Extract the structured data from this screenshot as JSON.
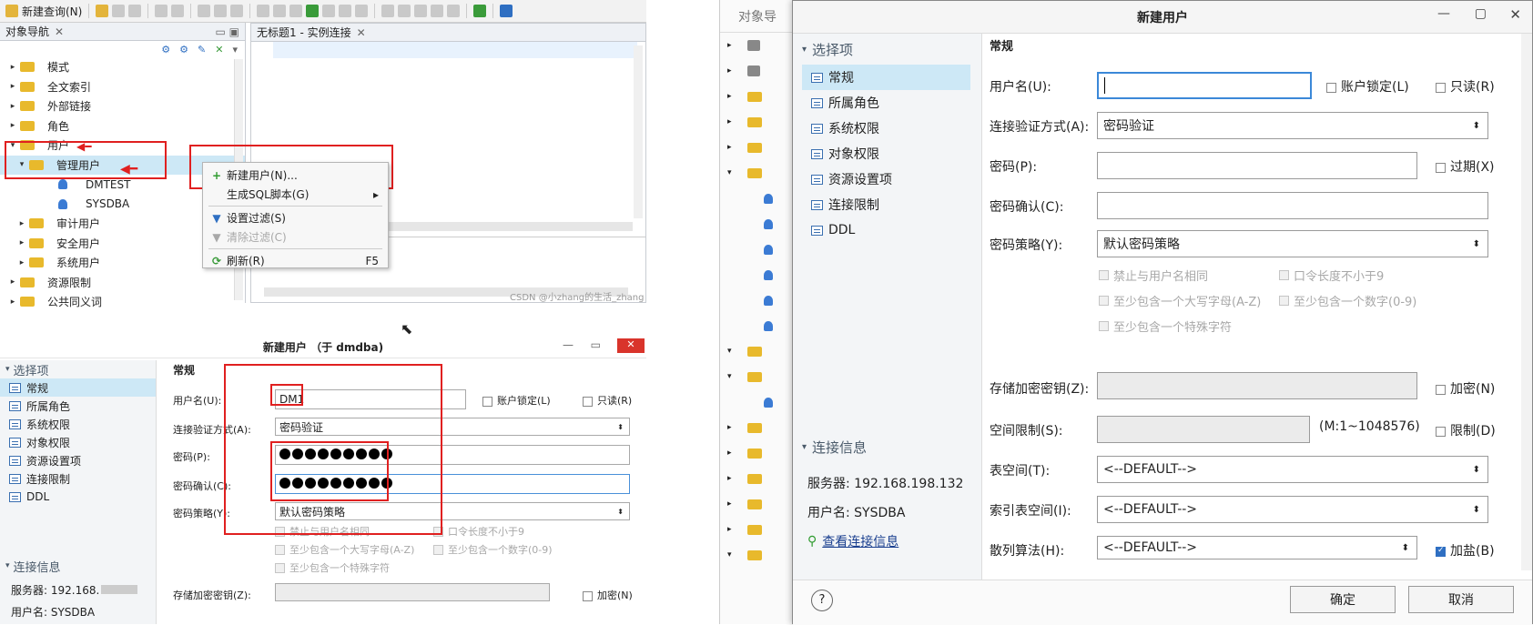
{
  "toolbar": {
    "new_query": "新建查询(N)"
  },
  "nav_panel": {
    "title": "对象导航",
    "editor_tab": "无标题1 - 实例连接"
  },
  "tree": [
    {
      "label": "模式",
      "level": 1,
      "icon": "folder",
      "expander": "▸"
    },
    {
      "label": "全文索引",
      "level": 1,
      "icon": "folder",
      "expander": "▸"
    },
    {
      "label": "外部链接",
      "level": 1,
      "icon": "folder",
      "expander": "▸"
    },
    {
      "label": "角色",
      "level": 1,
      "icon": "folder",
      "expander": "▸"
    },
    {
      "label": "用户",
      "level": 1,
      "icon": "folder",
      "expander": "▾"
    },
    {
      "label": "管理用户",
      "level": 2,
      "icon": "folder",
      "expander": "▾"
    },
    {
      "label": "DMTEST",
      "level": 3,
      "icon": "user",
      "expander": ""
    },
    {
      "label": "SYSDBA",
      "level": 3,
      "icon": "user",
      "expander": ""
    },
    {
      "label": "审计用户",
      "level": 2,
      "icon": "folder",
      "expander": "▸"
    },
    {
      "label": "安全用户",
      "level": 2,
      "icon": "folder",
      "expander": "▸"
    },
    {
      "label": "系统用户",
      "level": 2,
      "icon": "folder",
      "expander": "▸"
    },
    {
      "label": "资源限制",
      "level": 1,
      "icon": "folder",
      "expander": "▸"
    },
    {
      "label": "公共同义词",
      "level": 1,
      "icon": "folder",
      "expander": "▸"
    }
  ],
  "context_menu": {
    "items": [
      {
        "label": "新建用户(N)...",
        "shortcut": "",
        "enabled": true,
        "icon": "plus-icon"
      },
      {
        "label": "生成SQL脚本(G)",
        "shortcut": "▸",
        "enabled": true,
        "icon": ""
      },
      {
        "label": "设置过滤(S)",
        "shortcut": "",
        "enabled": true,
        "icon": "filter-icon"
      },
      {
        "label": "清除过滤(C)",
        "shortcut": "",
        "enabled": false,
        "icon": "filter-icon"
      },
      {
        "label": "刷新(R)",
        "shortcut": "F5",
        "enabled": true,
        "icon": "refresh-icon"
      }
    ]
  },
  "watermark": "CSDN @小zhang的生活_zhang",
  "small_dialog": {
    "title": "新建用户 （于 dmdba)",
    "nav_header": "选择项",
    "nav_items": [
      "常规",
      "所属角色",
      "系统权限",
      "对象权限",
      "资源设置项",
      "连接限制",
      "DDL"
    ],
    "section": "常规",
    "labels": {
      "username": "用户名(U):",
      "auth": "连接验证方式(A):",
      "password": "密码(P):",
      "confirm": "密码确认(C):",
      "policy": "密码策略(Y):",
      "store_key": "存储加密密钥(Z):"
    },
    "values": {
      "username": "DM1",
      "auth": "密码验证",
      "policy": "默认密码策略"
    },
    "checks": {
      "lock": "账户锁定(L)",
      "readonly": "只读(R)",
      "encrypt": "加密(N)"
    },
    "policy_opts": [
      "禁止与用户名相同",
      "口令长度不小于9",
      "至少包含一个大写字母(A-Z)",
      "至少包含一个数字(0-9)",
      "至少包含一个特殊字符"
    ],
    "conn_header": "连接信息",
    "server": "服务器: 192.168.",
    "user": "用户名: SYSDBA"
  },
  "right_bg": {
    "title": "对象导"
  },
  "big_dialog": {
    "title": "新建用户",
    "nav_header": "选择项",
    "nav_items": [
      "常规",
      "所属角色",
      "系统权限",
      "对象权限",
      "资源设置项",
      "连接限制",
      "DDL"
    ],
    "section": "常规",
    "labels": {
      "username": "用户名(U):",
      "auth": "连接验证方式(A):",
      "password": "密码(P):",
      "confirm": "密码确认(C):",
      "policy": "密码策略(Y):",
      "store_key": "存储加密密钥(Z):",
      "space": "空间限制(S):",
      "tablespace": "表空间(T):",
      "idx_tablespace": "索引表空间(I):",
      "hash": "散列算法(H):"
    },
    "values": {
      "auth": "密码验证",
      "policy": "默认密码策略",
      "space_hint": "(M:1~1048576)",
      "tablespace": "<--DEFAULT-->",
      "idx_tablespace": "<--DEFAULT-->",
      "hash": "<--DEFAULT-->"
    },
    "checks": {
      "lock": "账户锁定(L)",
      "readonly": "只读(R)",
      "expire": "过期(X)",
      "encrypt": "加密(N)",
      "limit": "限制(D)",
      "salt": "加盐(B)"
    },
    "policy_opts": [
      "禁止与用户名相同",
      "口令长度不小于9",
      "至少包含一个大写字母(A-Z)",
      "至少包含一个数字(0-9)",
      "至少包含一个特殊字符"
    ],
    "conn_header": "连接信息",
    "server": "服务器: 192.168.198.132",
    "user": "用户名: SYSDBA",
    "view_conn": "查看连接信息",
    "ok": "确定",
    "cancel": "取消",
    "help": "?"
  }
}
